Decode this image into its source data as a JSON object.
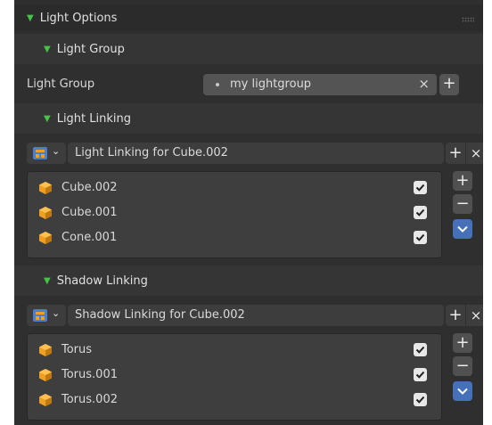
{
  "panel": {
    "light_options": {
      "label": "Light Options",
      "toggle_icon": "triangle-down-icon"
    },
    "light_group_section": {
      "label": "Light Group"
    },
    "light_group_field": {
      "label": "Light Group",
      "value": "my lightgroup",
      "clear_glyph": "×",
      "add_glyph": "+"
    },
    "light_linking_section": {
      "label": "Light Linking"
    },
    "light_linking": {
      "collection_name": "Light Linking for Cube.002",
      "add_glyph": "+",
      "remove_glyph": "×",
      "items": [
        {
          "name": "Cube.002",
          "checked": true
        },
        {
          "name": "Cube.001",
          "checked": true
        },
        {
          "name": "Cone.001",
          "checked": true
        }
      ],
      "side": {
        "add": "+",
        "remove": "−"
      }
    },
    "shadow_linking_section": {
      "label": "Shadow Linking"
    },
    "shadow_linking": {
      "collection_name": "Shadow Linking for Cube.002",
      "add_glyph": "+",
      "remove_glyph": "×",
      "items": [
        {
          "name": "Torus",
          "checked": true
        },
        {
          "name": "Torus.001",
          "checked": true
        },
        {
          "name": "Torus.002",
          "checked": true
        }
      ],
      "side": {
        "add": "+",
        "remove": "−"
      }
    }
  },
  "colors": {
    "panel_bg": "#2f2f2f",
    "field_bg": "#545454",
    "accent_triangle": "#46c348",
    "cube_icon": "#f0a020",
    "blue_button": "#4671b8"
  }
}
